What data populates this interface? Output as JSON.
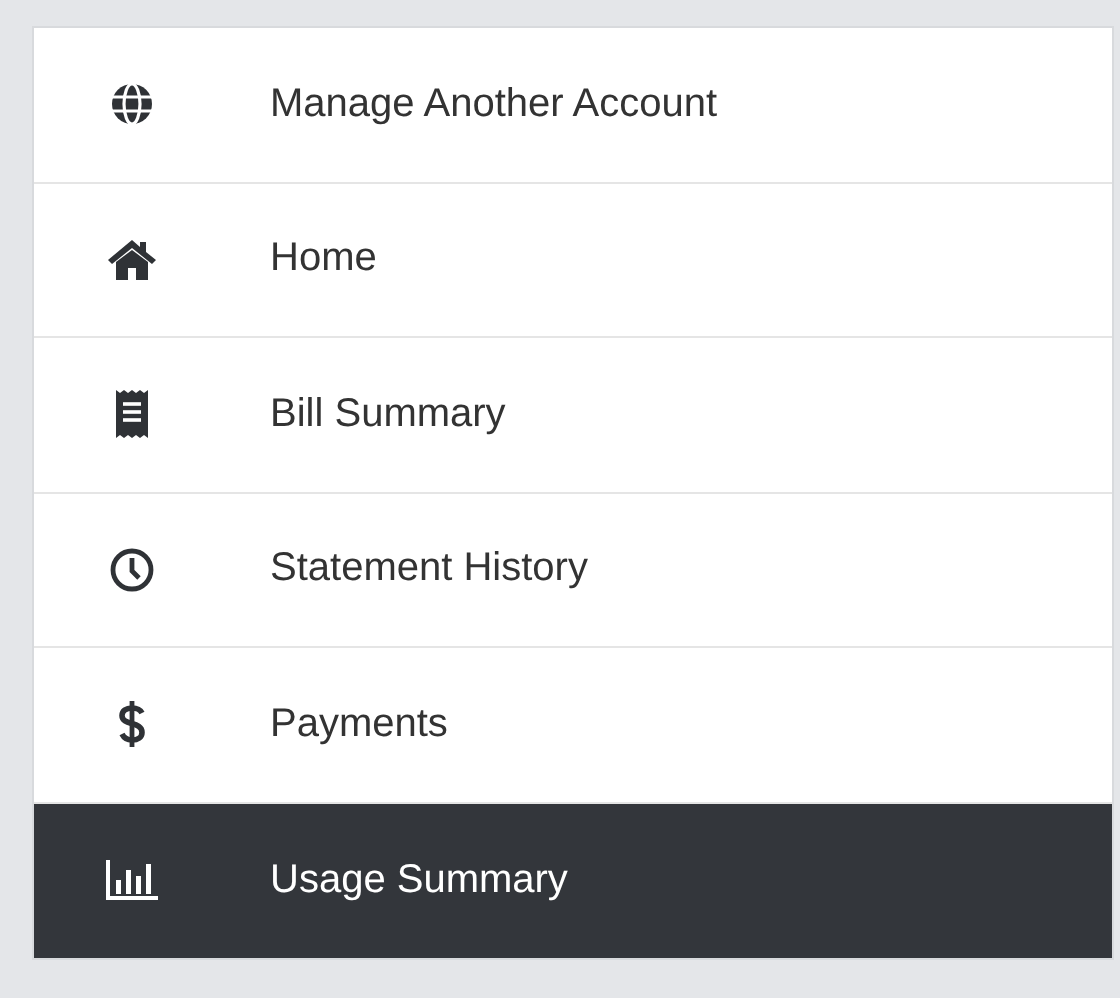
{
  "menu": {
    "items": [
      {
        "label": "Manage Another Account",
        "selected": false
      },
      {
        "label": "Home",
        "selected": false
      },
      {
        "label": "Bill Summary",
        "selected": false
      },
      {
        "label": "Statement History",
        "selected": false
      },
      {
        "label": "Payments",
        "selected": false
      },
      {
        "label": "Usage Summary",
        "selected": true
      }
    ]
  }
}
